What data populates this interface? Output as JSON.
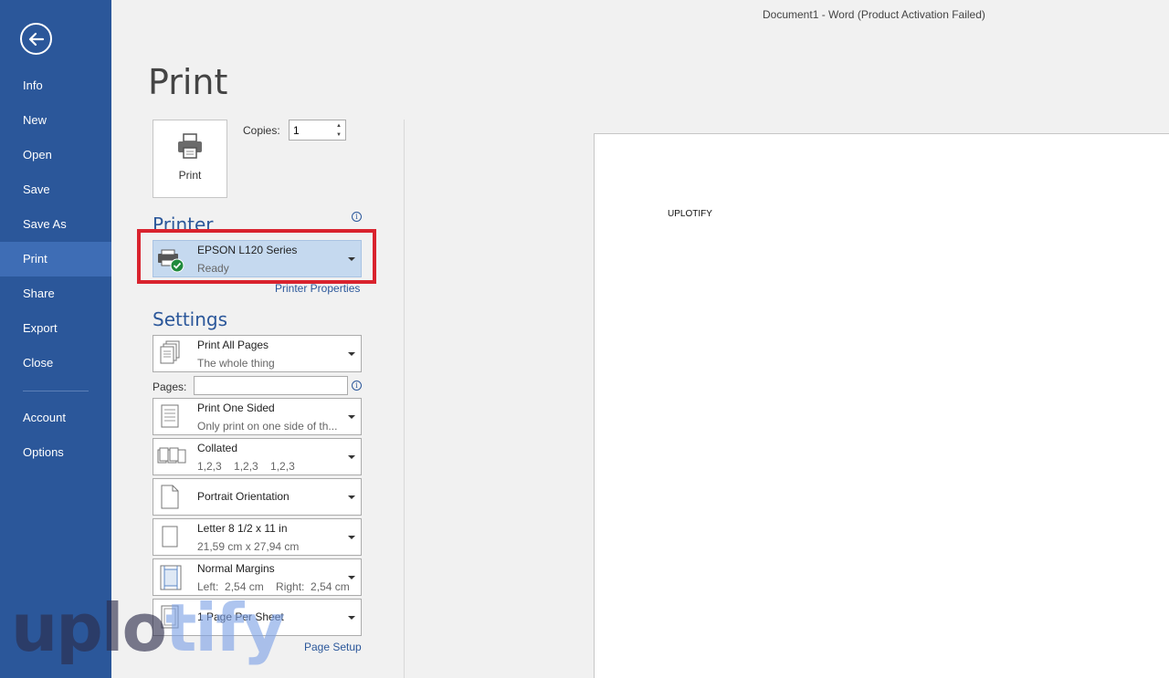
{
  "window": {
    "title": "Document1 - Word (Product Activation Failed)"
  },
  "sidebar": {
    "items": [
      {
        "label": "Info",
        "active": false
      },
      {
        "label": "New",
        "active": false
      },
      {
        "label": "Open",
        "active": false
      },
      {
        "label": "Save",
        "active": false
      },
      {
        "label": "Save As",
        "active": false
      },
      {
        "label": "Print",
        "active": true
      },
      {
        "label": "Share",
        "active": false
      },
      {
        "label": "Export",
        "active": false
      },
      {
        "label": "Close",
        "active": false
      },
      {
        "label": "Account",
        "active": false
      },
      {
        "label": "Options",
        "active": false
      }
    ]
  },
  "print": {
    "heading": "Print",
    "button_label": "Print",
    "copies_label": "Copies:",
    "copies_value": "1"
  },
  "printer": {
    "section_title": "Printer",
    "name": "EPSON L120 Series",
    "status": "Ready",
    "properties_link": "Printer Properties"
  },
  "settings": {
    "section_title": "Settings",
    "pages_label": "Pages:",
    "pages_value": "",
    "options": [
      {
        "main": "Print All Pages",
        "sub": "The whole thing"
      },
      {
        "main": "Print One Sided",
        "sub": "Only print on one side of th..."
      },
      {
        "main": "Collated",
        "sub": "1,2,3    1,2,3    1,2,3"
      },
      {
        "main": "Portrait Orientation",
        "sub": ""
      },
      {
        "main": "Letter 8 1/2 x 11 in",
        "sub": "21,59 cm x 27,94 cm"
      },
      {
        "main": "Normal Margins",
        "sub": "Left:  2,54 cm    Right:  2,54 cm"
      },
      {
        "main": "1 Page Per Sheet",
        "sub": ""
      }
    ],
    "page_setup_link": "Page Setup"
  },
  "preview": {
    "text": "UPLOTIFY"
  },
  "watermark": {
    "part1": "uplo",
    "part2": "tify"
  },
  "colors": {
    "sidebar": "#2b579a",
    "accent": "#2b579a",
    "highlight": "#d9232e",
    "selected": "#c5d9ef"
  }
}
